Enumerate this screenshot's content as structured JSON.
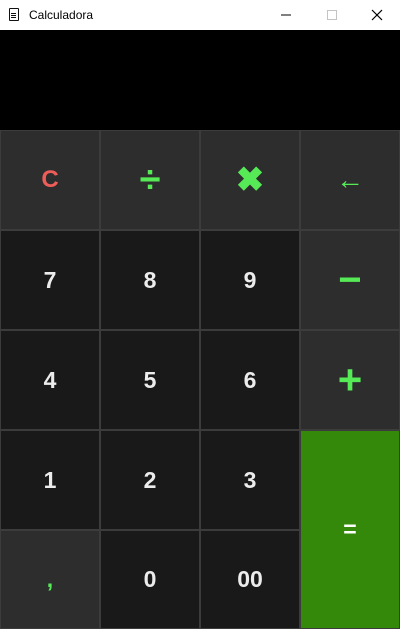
{
  "window": {
    "title": "Calculadora",
    "app_icon": "calculator-icon",
    "controls": [
      "minimize-icon",
      "maximize-icon",
      "close-icon"
    ]
  },
  "display": {
    "value": ""
  },
  "keys": {
    "clear": "C",
    "divide": "÷",
    "multiply": "✖",
    "backspace": "←",
    "seven": "7",
    "eight": "8",
    "nine": "9",
    "minus": "−",
    "four": "4",
    "five": "5",
    "six": "6",
    "plus": "+",
    "one": "1",
    "two": "2",
    "three": "3",
    "equals": "=",
    "comma": ",",
    "zero": "0",
    "double_zero": "00"
  },
  "colors": {
    "display_bg": "#000000",
    "digit_key_bg": "#19191a",
    "op_key_bg": "#2d2d2e",
    "equals_bg": "#34890a",
    "operator_fg": "#57ea57",
    "clear_fg": "#ef5d59",
    "digit_fg": "#ececec"
  }
}
